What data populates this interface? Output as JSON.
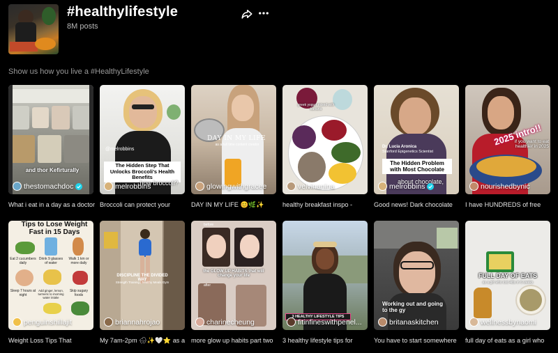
{
  "header": {
    "title": "#healthylifestyle",
    "post_count": "8M posts",
    "description": "Show us how you live a #HealthyLifestyle"
  },
  "icons": {
    "share": "share-arrow-icon",
    "more": "more-dots-icon",
    "verified": "verified-badge-icon"
  },
  "accent": "#20d5ec",
  "videos": [
    {
      "author": "thestomachdoc",
      "verified": true,
      "caption": "What i eat in a day as a doctor",
      "overlay": "and thor Kefirturally"
    },
    {
      "author": "melrobbins",
      "verified": false,
      "caption": "Broccoli can protect your",
      "overlay": "The Hidden Step That Unlocks Broccoli's Health Benefits",
      "overlay2": "@melrobbins",
      "overlay3": "how broccoli?"
    },
    {
      "author": "glowingwithgracee",
      "verified": false,
      "caption": "DAY IN MY LIFE 😊🌿✨",
      "overlay": "DAY IN MY LIFE",
      "overlay2": "as a full time content creator"
    },
    {
      "author": "velvinanina",
      "verified": false,
      "caption": "healthy breakfast inspo -",
      "overlay": "greek yogurt mixed with banana"
    },
    {
      "author": "melrobbins",
      "verified": true,
      "caption": "Good news! Dark chocolate",
      "overlay": "The Hidden Problem with Most Chocolate",
      "overlay2": "Dr. Lucia Aronica",
      "overlay3": "Stanford Epigenetics Scientist",
      "overlay4": "about chocolate,"
    },
    {
      "author": "nourishedbynic",
      "verified": false,
      "caption": "I have HUNDREDS of free",
      "overlay": "2025 intro!!",
      "overlay2": "if you want to eat healthier in 2025"
    },
    {
      "author": "penguinshillajit",
      "verified": false,
      "caption": "Weight Loss Tips That",
      "overlay": "Tips to Lose Weight Fast in 15 Days",
      "tips": [
        "Eat 2 cucumbers daily",
        "Drink 9 glasses of water",
        "Walk 1 km or more daily",
        "Sleep 7 hours at night",
        "Add ginger, lemon, turmeric to morning water intake",
        "Skip sugary foods",
        "Eat bananas daily",
        "Eat green vegetables",
        "Take more protein"
      ]
    },
    {
      "author": "briannahrojao",
      "verified": false,
      "caption": "My 7am-2pm 🌧✨🤍⭐ as a",
      "overlay": "DISCIPLINE THE DIVIDED WAY",
      "overlay2": "Strength Training | healthy Meals Gym"
    },
    {
      "author": "charinecheung",
      "verified": false,
      "caption": "more glow up habits part two",
      "overlay": "the GLOW UP HABITS that will change your life",
      "overlay2": "before",
      "overlay3": "after"
    },
    {
      "author": "fitinfineswithpenel...",
      "verified": false,
      "caption": "3 healthy lifestyle tips for",
      "overlay": "3 HEALTHY LIFESTYLE TIPS"
    },
    {
      "author": "britanaskitchen",
      "verified": false,
      "caption": "You have to start somewhere",
      "overlay": "Working out and going to the gy"
    },
    {
      "author": "wellnessbynaomi",
      "verified": false,
      "caption": "full day of eats as a girl who",
      "overlay": "FULL DAY OF EATS",
      "overlay2": "as a girl who lost 4lbs in 6 weeks"
    }
  ]
}
